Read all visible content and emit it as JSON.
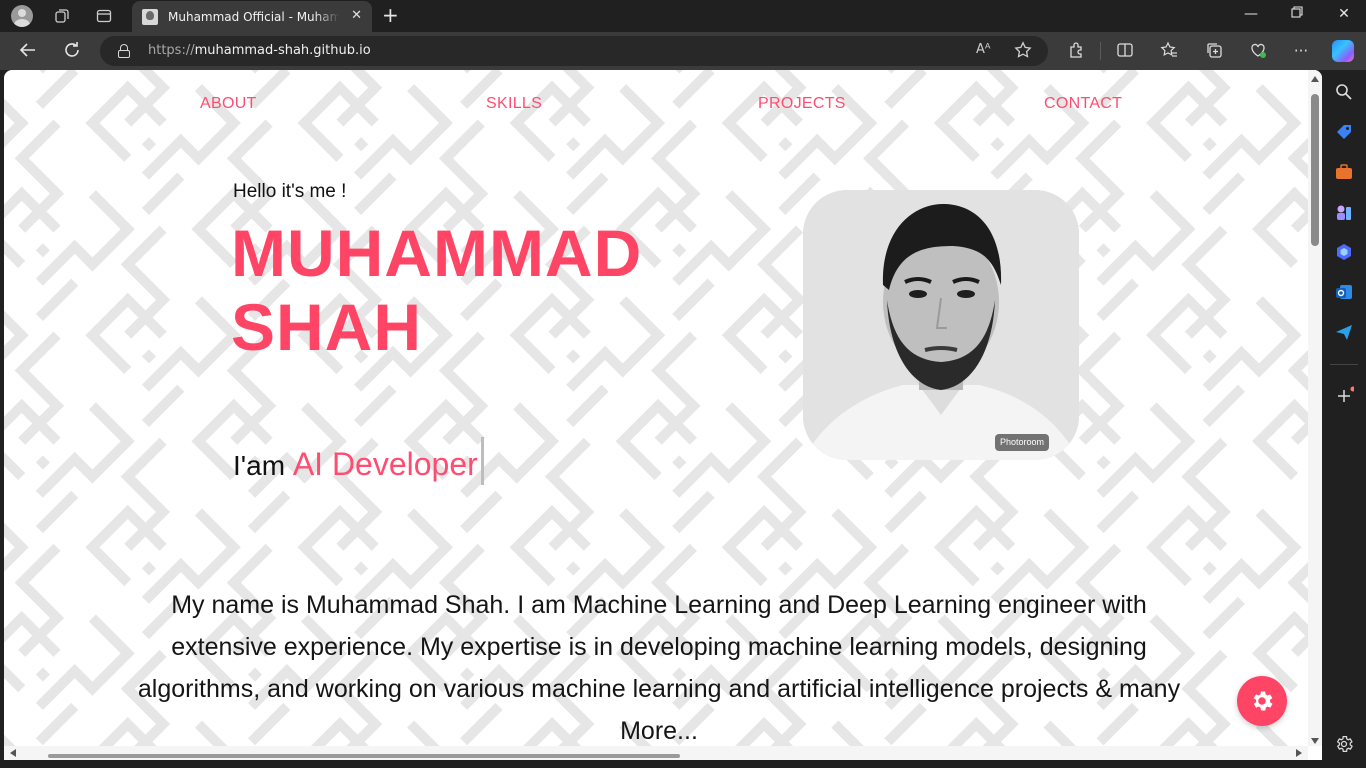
{
  "browser": {
    "tab": {
      "title": "Muhammad Official - Muhammad Shah"
    },
    "address": {
      "scheme": "https://",
      "host": "muhammad-shah.github.io"
    },
    "read_aloud_label": "Aᴬ"
  },
  "page": {
    "nav": [
      {
        "label": "ABOUT"
      },
      {
        "label": "SKILLS"
      },
      {
        "label": "PROJECTS"
      },
      {
        "label": "CONTACT"
      }
    ],
    "hero": {
      "greeting": "Hello it's me !",
      "name_line1": "MUHAMMAD",
      "name_line2": "SHAH",
      "iam_prefix": "I'am",
      "role": "AI Developer",
      "photo_badge": "Photoroom"
    },
    "bio": "My name is Muhammad Shah. I am Machine Learning and Deep Learning engineer with extensive experience. My expertise is in developing machine learning models, designing algorithms, and working on various machine learning and artificial intelligence projects & many More...",
    "accent_color": "#ff4566"
  },
  "icons": [
    "profile-icon",
    "workspaces-icon",
    "tab-actions-icon",
    "back-icon",
    "refresh-icon",
    "lock-icon",
    "read-aloud-icon",
    "favorite-star-icon",
    "extensions-icon",
    "split-screen-icon",
    "favorites-icon",
    "collections-icon",
    "browser-essentials-icon",
    "more-icon",
    "copilot-icon",
    "gear-icon"
  ]
}
